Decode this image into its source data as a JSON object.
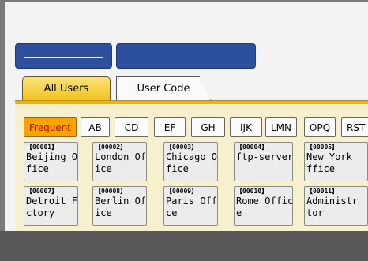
{
  "tabs": [
    {
      "label": "All Users"
    },
    {
      "label": "User Code"
    }
  ],
  "filters": [
    "Frequent",
    "AB",
    "CD",
    "EF",
    "GH",
    "IJK",
    "LMN",
    "OPQ",
    "RST"
  ],
  "users": [
    {
      "code": "【00001】",
      "name": "Beijing Of\nfice"
    },
    {
      "code": "【00002】",
      "name": "London Off\nice"
    },
    {
      "code": "【00003】",
      "name": "Chicago Of\nfice"
    },
    {
      "code": "【00004】",
      "name": "ftp-server"
    },
    {
      "code": "【00005】",
      "name": "New York\nffice"
    },
    {
      "code": "【00007】",
      "name": "Detroit Fa\nctory"
    },
    {
      "code": "【00008】",
      "name": "Berlin Off\nice"
    },
    {
      "code": "【00009】",
      "name": "Paris Offi\nce"
    },
    {
      "code": "【00010】",
      "name": "Rome Offic\ne"
    },
    {
      "code": "【00011】",
      "name": "Administr\ntor"
    }
  ],
  "colors": {
    "accent": "#f2c320",
    "header_bar": "#2c4f9e",
    "active_filter": "#f6a500"
  }
}
